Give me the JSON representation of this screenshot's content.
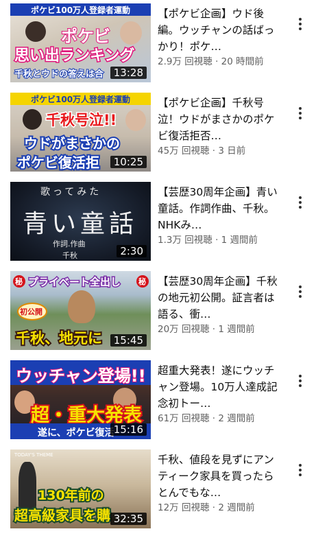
{
  "videos": [
    {
      "title": "【ポケビ企画】ウド後編。ウッチャンの話ばっかり！ポケ…",
      "views": "2.9万 回視聴",
      "age": "20 時間前",
      "duration": "13:28",
      "thumb_text": [
        "ポケビ100万人登録者運動",
        "ポケビ",
        "思い出ランキング",
        "千秋とウドの答えは合"
      ]
    },
    {
      "title": "【ポケビ企画】千秋号泣！ウドがまさかのポケビ復活拒否…",
      "views": "45万 回視聴",
      "age": "3 日前",
      "duration": "10:25",
      "thumb_text": [
        "ポケビ100万人登録者運動",
        "千秋号泣!!",
        "ウドがまさかの",
        "ポケビ復活拒"
      ]
    },
    {
      "title": "【芸歴30周年企画】青い童話。作詞作曲、千秋。NHKみ…",
      "views": "1.3万 回視聴",
      "age": "1 週間前",
      "duration": "2:30",
      "thumb_text": [
        "歌ってみた",
        "青い童話",
        "作詞.作曲",
        "千秋"
      ]
    },
    {
      "title": "【芸歴30周年企画】千秋の地元初公開。証言者は語る、衝…",
      "views": "20万 回視聴",
      "age": "1 週間前",
      "duration": "15:45",
      "thumb_text": [
        "秘",
        "プライベート全出し",
        "秘",
        "初公開",
        "千秋、地元に"
      ]
    },
    {
      "title": "超重大発表！遂にウッチャン登場。10万人達成記念初トー…",
      "views": "61万 回視聴",
      "age": "2 週間前",
      "duration": "15:16",
      "thumb_text": [
        "ウッチャン登場!!",
        "超・重大発表",
        "遂に、ポケビ復活"
      ]
    },
    {
      "title": "千秋、値段を見ずにアンティーク家具を買ったらとんでもな…",
      "views": "12万 回視聴",
      "age": "2 週間前",
      "duration": "32:35",
      "thumb_text": [
        "TODAY'S THEME",
        "130年前の",
        "超高級家具を購"
      ]
    }
  ],
  "separator": "·",
  "icons": {
    "menu": "more-vert-icon"
  }
}
